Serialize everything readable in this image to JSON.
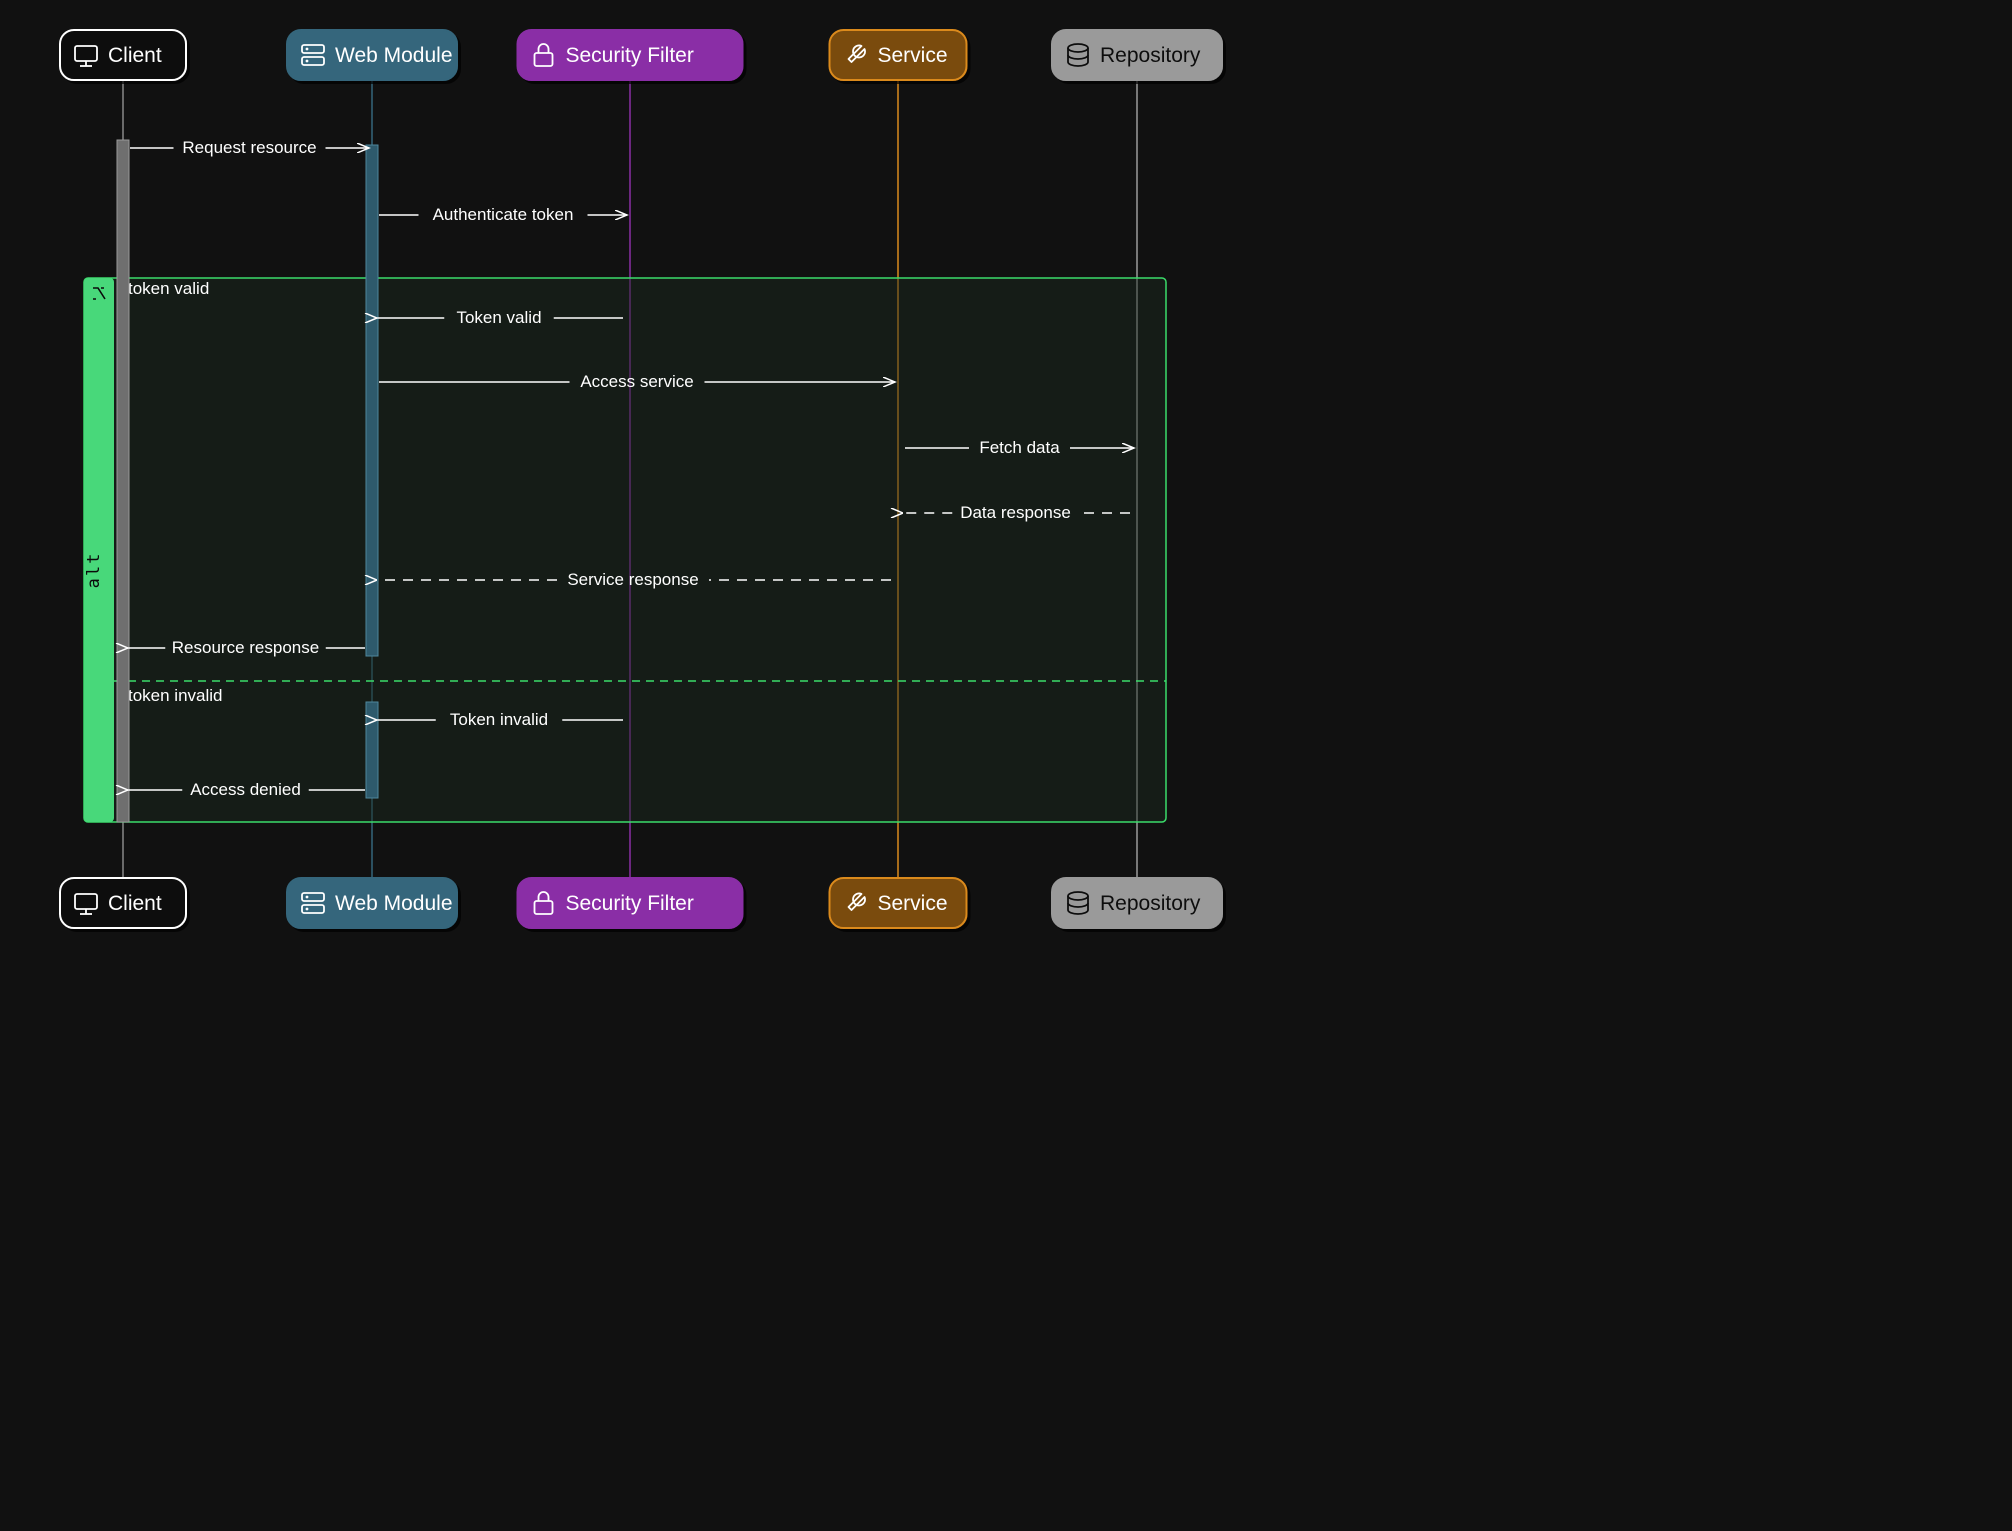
{
  "participants": [
    {
      "id": "client",
      "label": "Client",
      "icon": "monitor",
      "fill": "#0f0f0f",
      "stroke": "#ffffff",
      "text": "#ffffff",
      "lifeline": "#888888"
    },
    {
      "id": "web",
      "label": "Web Module",
      "icon": "server",
      "fill": "#34667b",
      "stroke": "#34667b",
      "text": "#ffffff",
      "lifeline": "#34667b"
    },
    {
      "id": "security",
      "label": "Security Filter",
      "icon": "lock",
      "fill": "#8a2fa6",
      "stroke": "#8a2fa6",
      "text": "#ffffff",
      "lifeline": "#8a2fa6"
    },
    {
      "id": "service",
      "label": "Service",
      "icon": "wrench",
      "fill": "#7a4b10",
      "stroke": "#db8a1e",
      "text": "#ffffff",
      "lifeline": "#db8a1e"
    },
    {
      "id": "repository",
      "label": "Repository",
      "icon": "database",
      "fill": "#9a9a9a",
      "stroke": "#9a9a9a",
      "text": "#111111",
      "lifeline": "#9a9a9a"
    }
  ],
  "alt_block": {
    "label": "alt",
    "option1_label": "token valid",
    "option2_label": "token invalid"
  },
  "messages": {
    "m1": "Request resource",
    "m2": "Authenticate token",
    "m3": "Token valid",
    "m4": "Access service",
    "m5": "Fetch data",
    "m6": "Data response",
    "m7": "Service response",
    "m8": "Resource response",
    "m9": "Token invalid",
    "m10": "Access denied"
  }
}
